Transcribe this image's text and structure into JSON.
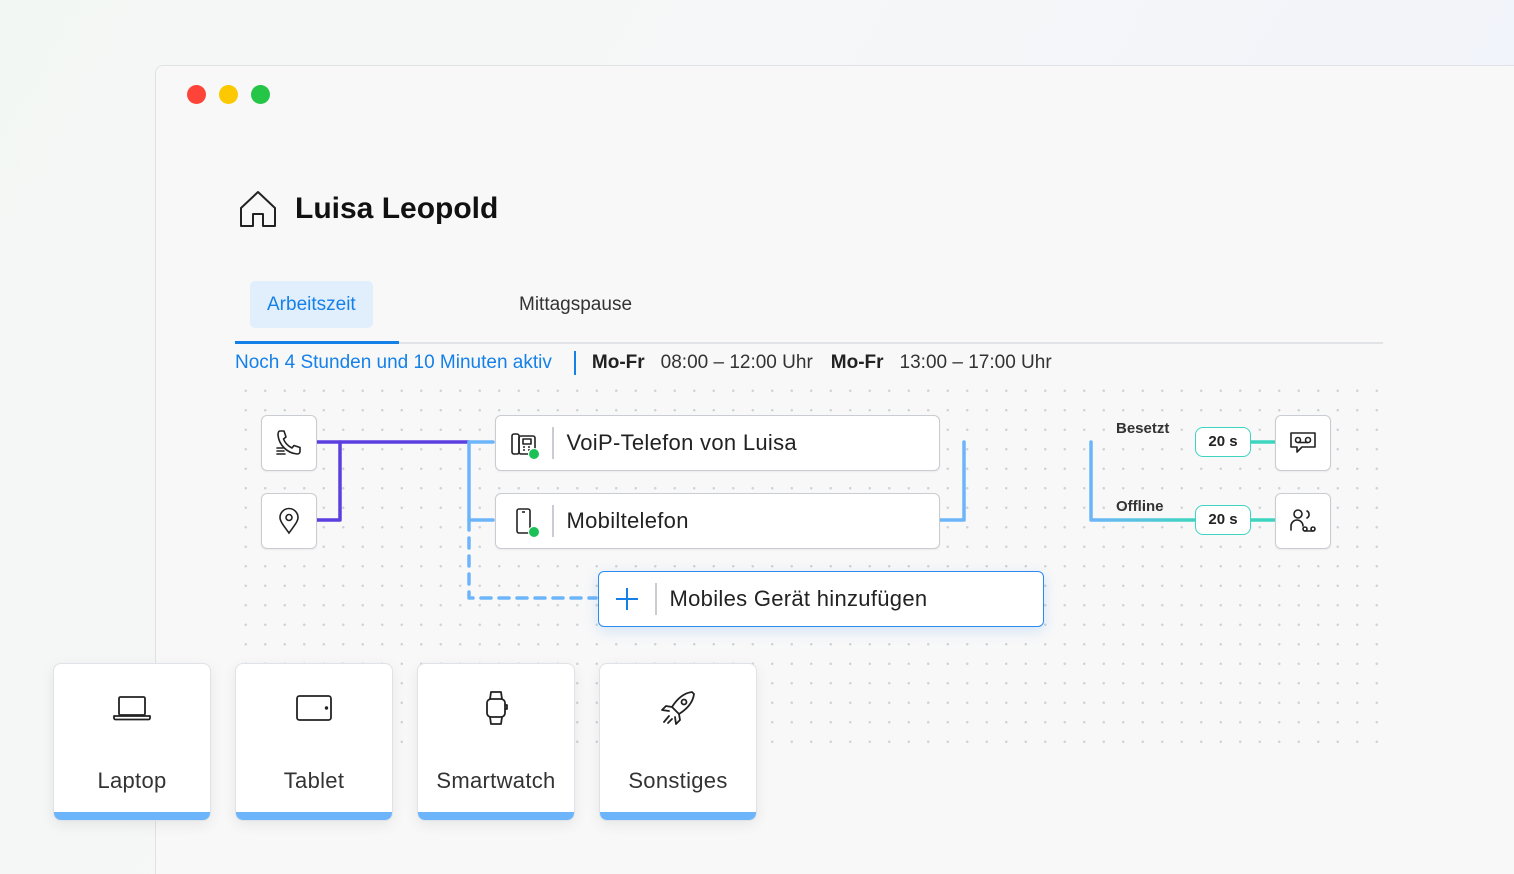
{
  "window": {
    "controls": [
      "close",
      "minimize",
      "maximize"
    ]
  },
  "header": {
    "icon": "home-icon",
    "title": "Luisa Leopold"
  },
  "tabs": [
    {
      "label": "Arbeitszeit",
      "active": true
    },
    {
      "label": "Mittagspause",
      "active": false
    }
  ],
  "status": {
    "active_text": "Noch 4 Stunden und 10 Minuten aktiv",
    "schedules": [
      {
        "days": "Mo-Fr",
        "time": "08:00 – 12:00 Uhr"
      },
      {
        "days": "Mo-Fr",
        "time": "13:00 – 17:00 Uhr"
      }
    ]
  },
  "triggers": [
    {
      "icon": "phone-incoming-icon"
    },
    {
      "icon": "location-pin-icon"
    }
  ],
  "devices": [
    {
      "label": "VoiP-Telefon von Luisa",
      "icon": "desk-phone-icon",
      "online": true
    },
    {
      "label": "Mobiltelefon",
      "icon": "mobile-phone-icon",
      "online": true
    }
  ],
  "add_device": {
    "label": "Mobiles Gerät hinzufügen",
    "icon": "plus-icon"
  },
  "fallbacks": [
    {
      "condition": "Besetzt",
      "delay": "20 s",
      "icon": "voicemail-icon"
    },
    {
      "condition": "Offline",
      "delay": "20 s",
      "icon": "group-forward-icon"
    }
  ],
  "device_types": [
    {
      "label": "Laptop",
      "icon": "laptop-icon"
    },
    {
      "label": "Tablet",
      "icon": "tablet-icon"
    },
    {
      "label": "Smartwatch",
      "icon": "smartwatch-icon"
    },
    {
      "label": "Sonstiges",
      "icon": "rocket-icon"
    }
  ],
  "colors": {
    "accent": "#1580e8",
    "tab_active_bg": "#e1effd",
    "wire_purple": "#5b3fe0",
    "wire_blue": "#6db5fa",
    "wire_teal": "#3dd5bf",
    "online_green": "#1bc157",
    "close": "#fe4438",
    "minimize": "#fcc800",
    "maximize": "#25c548"
  }
}
